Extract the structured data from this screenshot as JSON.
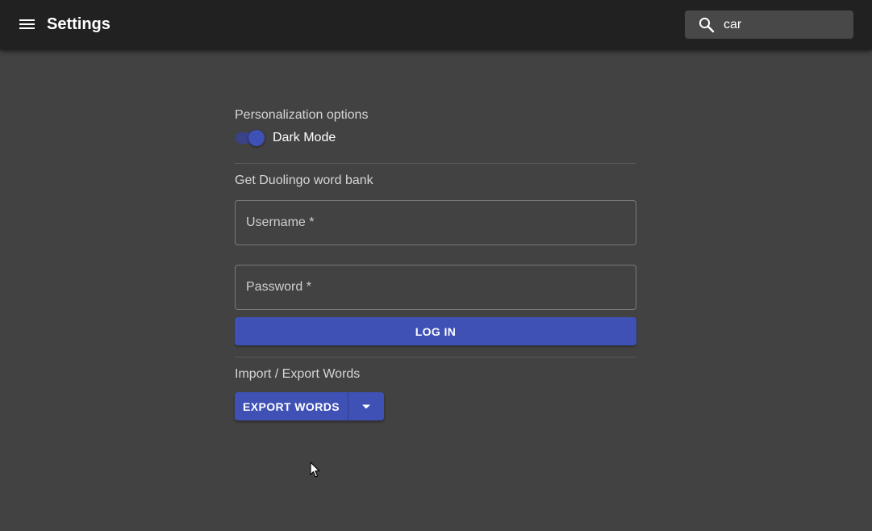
{
  "header": {
    "menu_icon": "hamburger-menu-icon",
    "title": "Settings",
    "search": {
      "icon": "search-icon",
      "value": "car",
      "placeholder": ""
    }
  },
  "personalization": {
    "title": "Personalization options",
    "dark_mode": {
      "label": "Dark Mode",
      "checked": true
    }
  },
  "duolingo": {
    "title": "Get Duolingo word bank",
    "username_placeholder": "Username *",
    "password_placeholder": "Password *",
    "login_label": "LOG IN"
  },
  "import_export": {
    "title": "Import / Export Words",
    "export_label": "EXPORT WORDS",
    "dropdown_icon": "arrow-drop-down-icon"
  },
  "colors": {
    "background": "#424242",
    "appbar": "#212121",
    "primary": "#3f51b5",
    "search_bg": "#484848"
  }
}
